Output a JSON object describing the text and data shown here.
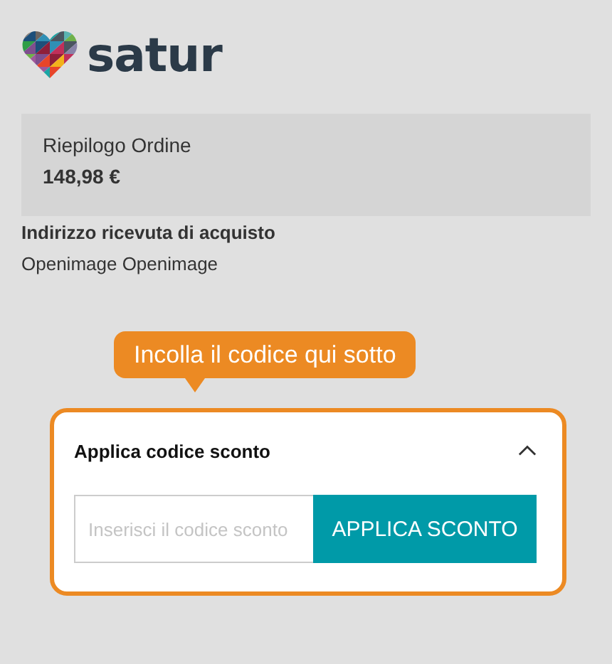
{
  "logo": {
    "text": "satur"
  },
  "summary": {
    "title": "Riepilogo Ordine",
    "total": "148,98 €"
  },
  "receipt_address": {
    "heading": "Indirizzo ricevuta di acquisto",
    "name": "Openimage Openimage"
  },
  "callout": {
    "text": "Incolla il codice qui sotto"
  },
  "discount": {
    "title": "Applica codice sconto",
    "expanded": true,
    "placeholder": "Inserisci il codice sconto",
    "button": "APPLICA SCONTO"
  }
}
